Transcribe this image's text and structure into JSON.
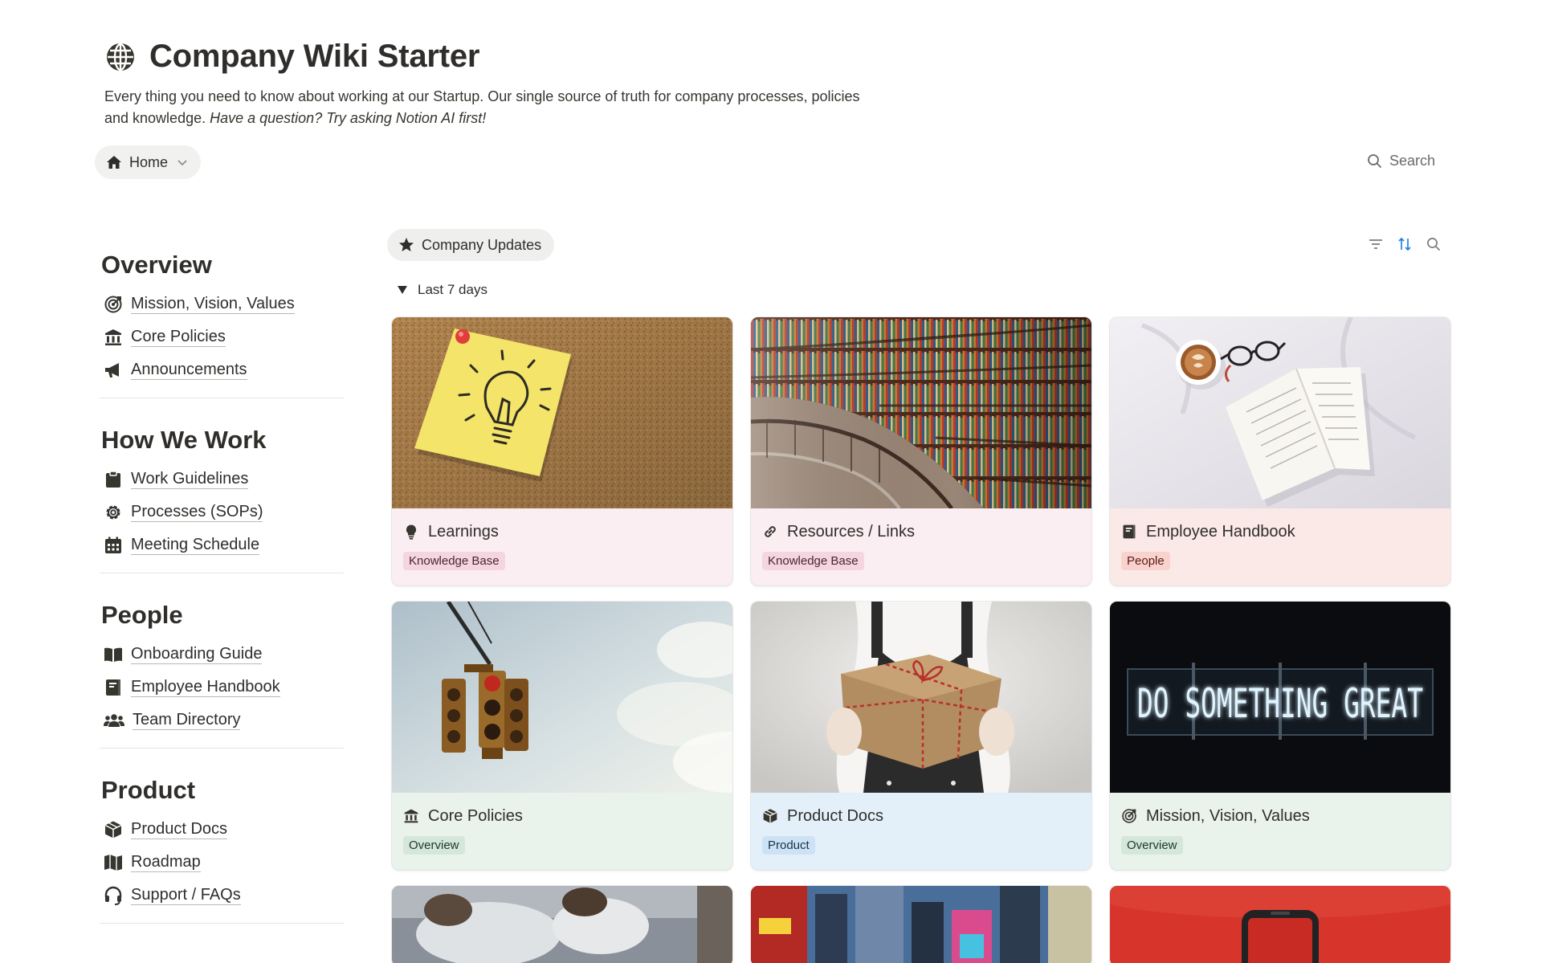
{
  "page": {
    "title": "Company Wiki Starter",
    "icon": "globe-icon",
    "description_plain": "Every thing you need to know about working at our Startup. Our single source of truth for company processes, policies and knowledge. ",
    "description_italic": "Have a question? Try asking Notion AI first!"
  },
  "nav_chip": {
    "label": "Home",
    "icon": "house-icon"
  },
  "search": {
    "label": "Search"
  },
  "sidebar": {
    "sections": [
      {
        "heading": "Overview",
        "items": [
          {
            "label": "Mission, Vision, Values",
            "icon": "target-icon"
          },
          {
            "label": "Core Policies",
            "icon": "bank-icon"
          },
          {
            "label": "Announcements",
            "icon": "megaphone-icon"
          }
        ]
      },
      {
        "heading": "How We Work",
        "items": [
          {
            "label": "Work Guidelines",
            "icon": "clipboard-icon"
          },
          {
            "label": "Processes (SOPs)",
            "icon": "gear-icon"
          },
          {
            "label": "Meeting Schedule",
            "icon": "calendar-icon"
          }
        ]
      },
      {
        "heading": "People",
        "items": [
          {
            "label": "Onboarding Guide",
            "icon": "book-open-icon"
          },
          {
            "label": "Employee Handbook",
            "icon": "handbook-icon"
          },
          {
            "label": "Team Directory",
            "icon": "people-icon"
          }
        ]
      },
      {
        "heading": "Product",
        "items": [
          {
            "label": "Product Docs",
            "icon": "package-icon"
          },
          {
            "label": "Roadmap",
            "icon": "map-icon"
          },
          {
            "label": "Support / FAQs",
            "icon": "headset-icon"
          }
        ]
      }
    ]
  },
  "view": {
    "tab_label": "Company Updates",
    "tab_icon": "star-icon",
    "group_label": "Last 7 days",
    "toolbar_icons": [
      "filter-icon",
      "sort-icon",
      "search-icon"
    ],
    "accent": "#2383e2"
  },
  "cards": [
    {
      "title": "Learnings",
      "icon": "lightbulb-icon",
      "tag": "Knowledge Base",
      "cover": "sticky-note-lightbulb-on-corkboard"
    },
    {
      "title": "Resources / Links",
      "icon": "link-icon",
      "tag": "Knowledge Base",
      "cover": "curved-library-bookshelves"
    },
    {
      "title": "Employee Handbook",
      "icon": "handbook-icon",
      "tag": "People",
      "cover": "open-book-coffee-glasses"
    },
    {
      "title": "Core Policies",
      "icon": "bank-icon",
      "tag": "Overview",
      "cover": "traffic-light-sky"
    },
    {
      "title": "Product Docs",
      "icon": "package-icon",
      "tag": "Product",
      "cover": "wrapped-gift-box"
    },
    {
      "title": "Mission, Vision, Values",
      "icon": "target-icon",
      "tag": "Overview",
      "cover": "neon-sign-do-something-great"
    }
  ],
  "cover_text": {
    "neon": "DO SOMETHING GREAT"
  },
  "colors": {
    "tag_pink_bg": "#f5d5df",
    "tag_rose_bg": "#f8d3cd",
    "tag_green_bg": "#d5e7db",
    "tag_blue_bg": "#cde3f5"
  }
}
